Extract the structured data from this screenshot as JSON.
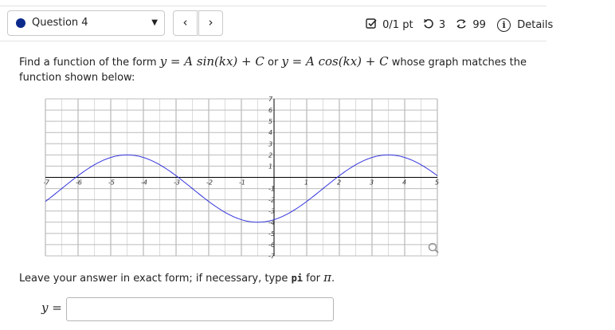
{
  "header": {
    "question_label": "Question 4",
    "prev_label": "‹",
    "next_label": "›",
    "points": "0/1 pt",
    "retries": "3",
    "attempts": "99",
    "details_label": "Details"
  },
  "prompt": {
    "part1": "Find a function of the form ",
    "form1": "y = A sin(kx) + C",
    "or": " or ",
    "form2": "y = A cos(kx) + C",
    "part2": " whose graph matches the function shown below:"
  },
  "graph": {
    "x_ticks": [
      "-7",
      "-6",
      "-5",
      "-4",
      "-3",
      "-2",
      "-1",
      "1",
      "2",
      "3",
      "4",
      "5"
    ],
    "y_ticks": [
      "7",
      "6",
      "5",
      "4",
      "3",
      "2",
      "1",
      "-1",
      "-2",
      "-3",
      "-4",
      "-5",
      "-6",
      "-7"
    ],
    "zoom_icon": "magnify-icon"
  },
  "chart_data": {
    "type": "line",
    "xlim": [
      -7,
      5
    ],
    "ylim": [
      -7,
      7
    ],
    "grid": true,
    "series": [
      {
        "function": "y = 3cos((π/4)(x + 4.5)) - 1",
        "amplitude": 4,
        "period": 8,
        "midline": -1,
        "x_range": [
          -7,
          5
        ],
        "color": "#3333dd"
      }
    ]
  },
  "answer": {
    "instruction_pre": "Leave your answer in exact form; if necessary, type ",
    "pi_code": "pi",
    "instruction_post": " for ",
    "pi_symbol": "π",
    "instruction_end": ".",
    "y_label": "y",
    "eq": "=",
    "value": ""
  }
}
